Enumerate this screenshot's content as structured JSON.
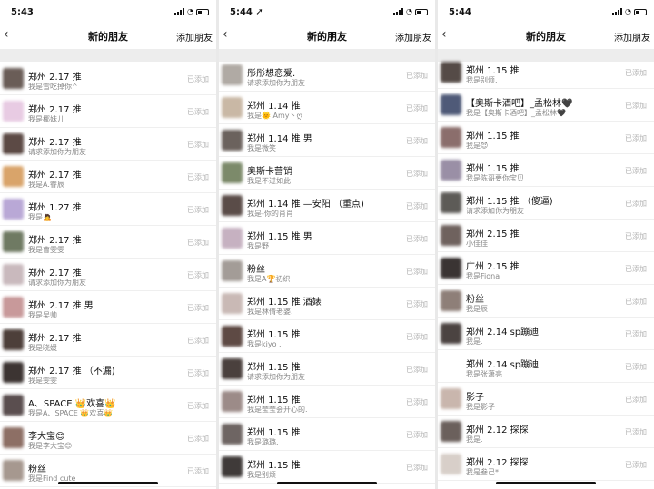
{
  "screens": [
    {
      "time": "5:43",
      "title": "新的朋友",
      "back_icon": "chevron-left-icon",
      "add_label": "添加朋友",
      "added_label": "已添加",
      "rows": [
        {
          "name": "郑州 2.17 推",
          "sub": "我是雪吃掉你^",
          "color": "#6a5d57"
        },
        {
          "name": "郑州 2.17 推",
          "sub": "我是椰妹儿",
          "color": "#e8cbe3"
        },
        {
          "name": "郑州 2.17 推",
          "sub": "请求添加你为朋友",
          "color": "#5c4a45"
        },
        {
          "name": "郑州 2.17 推",
          "sub": "我是A.睿辰",
          "color": "#d9a46a"
        },
        {
          "name": "郑州 1.27 推",
          "sub": "我是🙇",
          "color": "#b9a8d6"
        },
        {
          "name": "郑州 2.17 推",
          "sub": "我是曹雯雯",
          "color": "#6f7a63"
        },
        {
          "name": "郑州 2.17 推",
          "sub": "请求添加你为朋友",
          "color": "#c9b9bd"
        },
        {
          "name": "郑州 2.17 推 男",
          "sub": "我是吴帅",
          "color": "#c8999a"
        },
        {
          "name": "郑州 2.17 推",
          "sub": "我是晓媛",
          "color": "#4d3f3a"
        },
        {
          "name": "郑州 2.17 推 （不漏)",
          "sub": "我是雯雯",
          "color": "#3c3432"
        },
        {
          "name": "A、SPACE 👑欢喜👑",
          "sub": "我是A、SPACE 👑欢喜👑",
          "color": "#5a4e4f"
        },
        {
          "name": "李大宝😊",
          "sub": "我是李大宝😊",
          "color": "#8d6f65"
        },
        {
          "name": "粉丝",
          "sub": "我是Find cute",
          "color": "#a6988f"
        }
      ]
    },
    {
      "time": "5:44 ➚",
      "title": "新的朋友",
      "back_icon": "chevron-left-icon",
      "add_label": "添加朋友",
      "added_label": "已添加",
      "rows": [
        {
          "name": "彤彤想恋爱.",
          "sub": "请求添加你为朋友",
          "color": "#b0aaa4"
        },
        {
          "name": "郑州 1.14 推",
          "sub": "我是🌞 Amy丶ღ",
          "color": "#c9b8a5"
        },
        {
          "name": "郑州 1.14 推 男",
          "sub": "我是微笑",
          "color": "#6b625d"
        },
        {
          "name": "奥斯卡营销",
          "sub": "我是不过如此",
          "color": "#7c8a6a"
        },
        {
          "name": "郑州 1.14 推 —安阳 （重点)",
          "sub": "我是-你的肖肖",
          "color": "#5a4c48"
        },
        {
          "name": "郑州 1.15 推 男",
          "sub": "我是野",
          "color": "#c6b1c1"
        },
        {
          "name": "粉丝",
          "sub": "我是A🏆初织",
          "color": "#a39c97"
        },
        {
          "name": "郑州 1.15 推 酒婊",
          "sub": "我是林倩老婆.",
          "color": "#c9b9b5"
        },
        {
          "name": "郑州 1.15 推",
          "sub": "我是kiyo .",
          "color": "#5e4a44"
        },
        {
          "name": "郑州 1.15 推",
          "sub": "请求添加你为朋友",
          "color": "#4a403d"
        },
        {
          "name": "郑州 1.15 推",
          "sub": "我是莹莹会开心的.",
          "color": "#9c8b88"
        },
        {
          "name": "郑州 1.15 推",
          "sub": "我是璐璐.",
          "color": "#6e6563"
        },
        {
          "name": "郑州 1.15 推",
          "sub": "我是别烦",
          "color": "#3f3a39"
        }
      ]
    },
    {
      "time": "5:44",
      "title": "新的朋友",
      "back_icon": "chevron-left-icon",
      "add_label": "添加朋友",
      "added_label": "已添加",
      "rows": [
        {
          "name": "郑州 1.15 推",
          "sub": "我是别烦.",
          "color": "#554b47"
        },
        {
          "name": "【奥斯卡酒吧】_孟松林🖤",
          "sub": "我是【奥斯卡酒吧】_孟松林🖤",
          "color": "#4f5a78"
        },
        {
          "name": "郑州 1.15 推",
          "sub": "我是😈",
          "color": "#8b6e6c"
        },
        {
          "name": "郑州 1.15 推",
          "sub": "我是陈哥要你宝贝",
          "color": "#9a8fa6"
        },
        {
          "name": "郑州 1.15 推 （傻逼)",
          "sub": "请求添加你为朋友",
          "color": "#5d5b57"
        },
        {
          "name": "郑州 2.15 推",
          "sub": "小佳佳",
          "color": "#6f625e"
        },
        {
          "name": "广州 2.15 推",
          "sub": "我是Fiona",
          "color": "#3a3433"
        },
        {
          "name": "粉丝",
          "sub": "我是辰",
          "color": "#8e7f78"
        },
        {
          "name": "郑州 2.14 sp蹦迪",
          "sub": "我是.",
          "color": "#4b4341"
        },
        {
          "name": "郑州 2.14 sp蹦迪",
          "sub": "我是张潇亮",
          "color": "#ffffff"
        },
        {
          "name": "影子",
          "sub": "我是影子",
          "color": "#c9b6ad"
        },
        {
          "name": "郑州 2.12 探探",
          "sub": "我是.",
          "color": "#6b605c"
        },
        {
          "name": "郑州 2.12 探探",
          "sub": "我是叁己*",
          "color": "#d8cfc9"
        }
      ]
    }
  ]
}
